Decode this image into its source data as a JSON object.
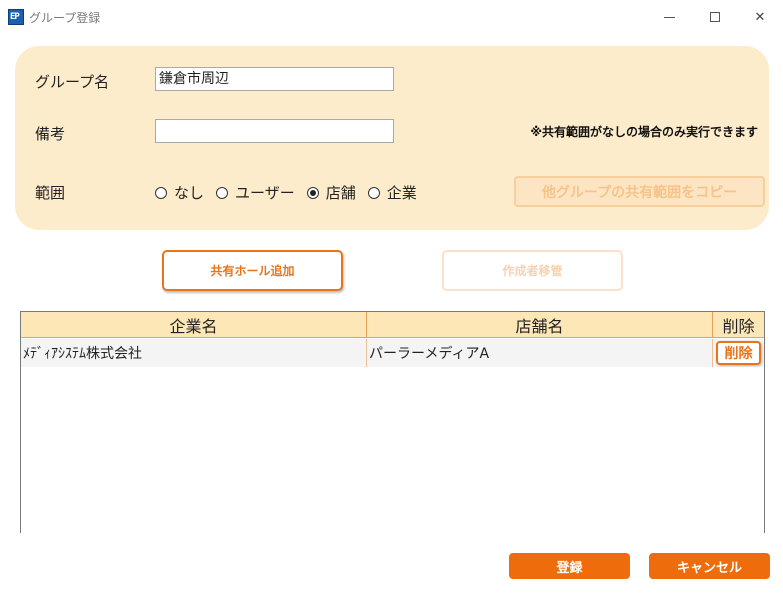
{
  "window": {
    "icon_text": "EP",
    "title": "グループ登録",
    "minimize_icon": "minimize-icon",
    "maximize_icon": "maximize-icon",
    "close_icon": "close-icon",
    "close_glyph": "✕"
  },
  "form": {
    "group_name_label": "グループ名",
    "group_name_value": "鎌倉市周辺",
    "remarks_label": "備考",
    "remarks_value": "",
    "scope_label": "範囲",
    "scope_options": [
      {
        "label": "なし",
        "selected": false
      },
      {
        "label": "ユーザー",
        "selected": false
      },
      {
        "label": "店舗",
        "selected": true
      },
      {
        "label": "企業",
        "selected": false
      }
    ],
    "note": "※共有範囲がなしの場合のみ実行できます",
    "copy_button_label": "他グループの共有範囲をコピー"
  },
  "actions": {
    "add_hall_label": "共有ホール追加",
    "transfer_creator_label": "作成者移管"
  },
  "table": {
    "headers": [
      "企業名",
      "店舗名",
      "削除"
    ],
    "rows": [
      {
        "company": "ﾒﾃﾞｨｱｼｽﾃﾑ株式会社",
        "store": "パーラーメディアA",
        "delete_label": "削除"
      }
    ]
  },
  "footer": {
    "register_label": "登録",
    "cancel_label": "キャンセル"
  },
  "colors": {
    "accent": "#ee6c0c",
    "panel_bg": "#fdeccb",
    "header_bg": "#fde7b7"
  }
}
